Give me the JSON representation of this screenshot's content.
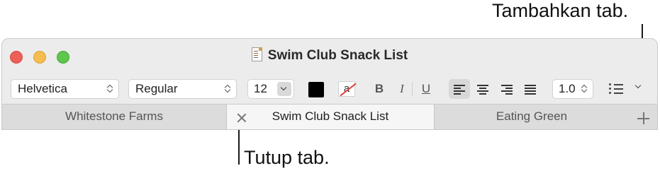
{
  "callouts": {
    "add_tab": "Tambahkan tab.",
    "close_tab": "Tutup tab."
  },
  "window": {
    "title": "Swim Club Snack List",
    "doc_icon": "document-icon"
  },
  "toolbar": {
    "font_family": "Helvetica",
    "font_style": "Regular",
    "font_size": "12",
    "text_color": "#000000",
    "bold_label": "B",
    "italic_label": "I",
    "underline_label": "U",
    "bg_color_label": "a",
    "line_spacing": "1.0",
    "alignment_selected": "left",
    "list_icon": "bulleted-list-icon"
  },
  "tabs": [
    {
      "label": "Whitestone Farms",
      "active": false
    },
    {
      "label": "Swim Club Snack List",
      "active": true
    },
    {
      "label": "Eating Green",
      "active": false
    }
  ],
  "colors": {
    "close": "#ee5f57",
    "minimize": "#f5bd4f",
    "maximize": "#5ec54d"
  }
}
